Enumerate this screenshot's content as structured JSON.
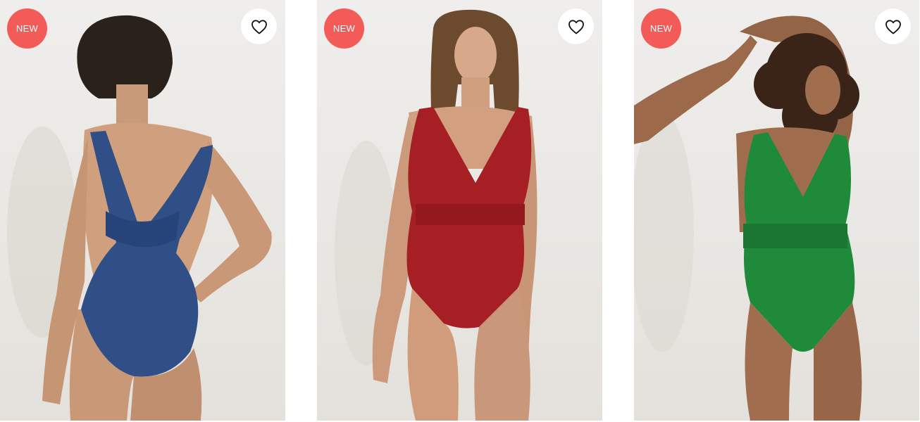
{
  "colors": {
    "badge_bg": "#f25b58",
    "background": "#ffffff",
    "swimsuit_blue": "#2f4f86",
    "swimsuit_red": "#a51f24",
    "swimsuit_green": "#1e8a3a"
  },
  "products": [
    {
      "badge": "NEW",
      "favorite_icon": "heart-outline-icon",
      "swimsuit_color": "blue"
    },
    {
      "badge": "NEW",
      "favorite_icon": "heart-outline-icon",
      "swimsuit_color": "red"
    },
    {
      "badge": "NEW",
      "favorite_icon": "heart-outline-icon",
      "swimsuit_color": "green"
    }
  ]
}
